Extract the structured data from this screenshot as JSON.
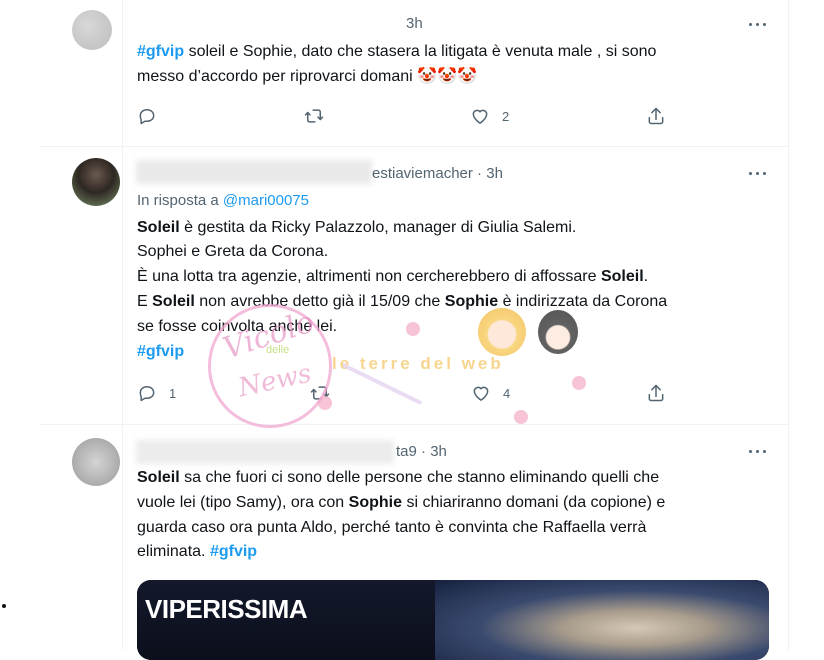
{
  "tweets": [
    {
      "time": "3h",
      "lines": [
        {
          "hashtag": "#gfvip",
          "text": " soleil e Sophie, dato che stasera la litigata è venuta male , si sono"
        },
        {
          "text": "messo d’accordo per riprovarci domani"
        }
      ],
      "emoji": "🤡🤡🤡",
      "actions": {
        "reply_count": "",
        "retweet_count": "",
        "like_count": "2"
      }
    },
    {
      "time": "3h",
      "header_handle": "estiaviemacher",
      "reply_prefix": "In risposta a",
      "reply_handle": "@mari00075",
      "lines": [
        {
          "text": "Soleil è gestita da Ricky Palazzolo, manager di Giulia Salemi."
        },
        {
          "text": "Sophei e Greta da Corona."
        },
        {
          "text": "È una lotta tra agenzie, altrimenti non cercherebbero di affossare Soleil."
        },
        {
          "text": "E Soleil non avrebbe detto già il 15/09 che Sophie è indirizzata da Corona"
        },
        {
          "text": "se fosse coinvolta anche lei."
        }
      ],
      "hashtag": "#gfvip",
      "actions": {
        "reply_count": "1",
        "retweet_count": "",
        "like_count": "4"
      }
    },
    {
      "time": "3h",
      "header_handle": "ta9",
      "lines": [
        {
          "text": "Soleil sa che fuori ci sono delle persone che stanno eliminando quelli che"
        },
        {
          "text": "vuole lei (tipo Samy), ora con Sophie si chiariranno domani (da copione) e"
        },
        {
          "text": "guarda caso ora punta Aldo, perché tanto è convinta che Raffaella verrà"
        },
        {
          "text": "eliminata."
        }
      ],
      "hashtag": "#gfvip",
      "media_label": "VIPERISSIMA"
    }
  ],
  "watermark": {
    "line1": "Vicolo",
    "line2": "delle",
    "line3": "News",
    "line4": "le terre del web"
  },
  "colors": {
    "link": "#1d9bf0",
    "text": "#0f1419",
    "muted": "#536471",
    "border": "#eff3f4"
  },
  "icons": [
    "reply-icon",
    "retweet-icon",
    "like-icon",
    "share-icon",
    "more-icon"
  ]
}
